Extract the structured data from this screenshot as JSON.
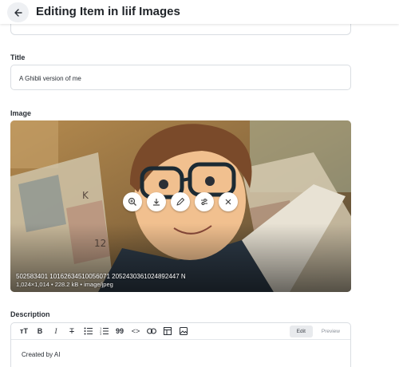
{
  "header": {
    "title": "Editing Item in liif Images"
  },
  "fields": {
    "title_label": "Title",
    "title_value": "A Ghibli version of me",
    "image_label": "Image",
    "description_label": "Description"
  },
  "image": {
    "filename": "502583401 1016263451005607​1 205243036102489244​7 N",
    "info": "1,024×1,014 • 228.2 kB • image/jpeg",
    "actions": [
      {
        "name": "zoom",
        "icon": "zoom-in-icon"
      },
      {
        "name": "download",
        "icon": "download-icon"
      },
      {
        "name": "edit",
        "icon": "pencil-icon"
      },
      {
        "name": "adjust",
        "icon": "sliders-icon"
      },
      {
        "name": "remove",
        "icon": "close-icon"
      }
    ]
  },
  "editor": {
    "toolbar": {
      "text_size": "тT",
      "bold": "B",
      "italic": "I",
      "strike": "T",
      "quote": "99",
      "code": "<>"
    },
    "edit_tab": "Edit",
    "preview_tab": "Preview",
    "content": "Created by AI"
  },
  "colors": {
    "accent_border": "#d9dde2",
    "title_text": "#1f2328"
  }
}
